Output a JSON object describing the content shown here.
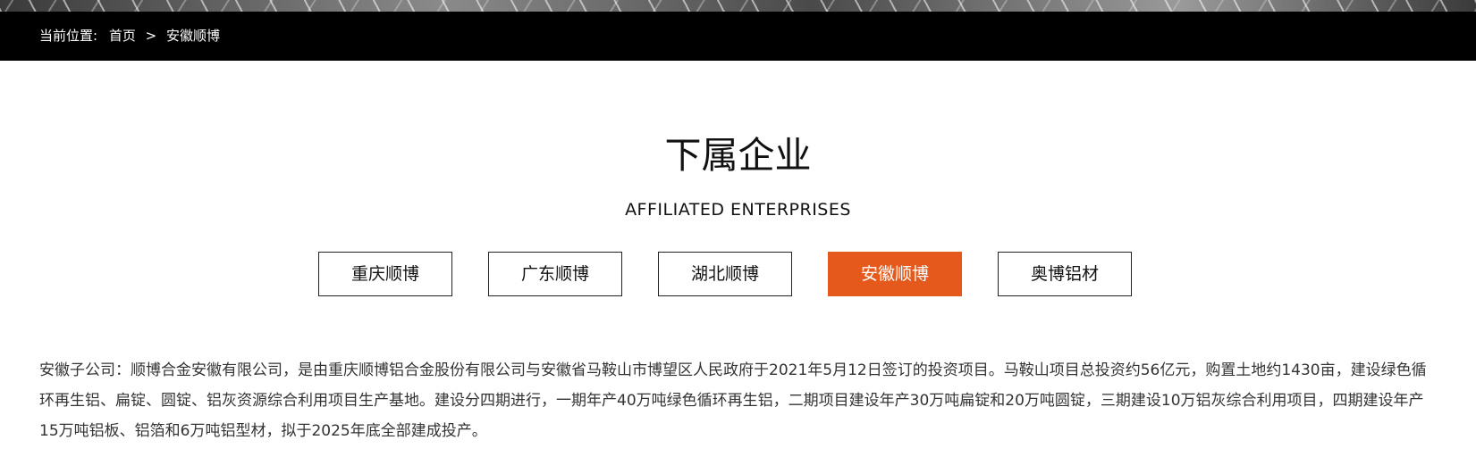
{
  "breadcrumb": {
    "prefix": "当前位置:",
    "home": "首页",
    "separator": ">",
    "current": "安徽顺博"
  },
  "section": {
    "title": "下属企业",
    "subtitle": "AFFILIATED ENTERPRISES"
  },
  "tabs": [
    {
      "label": "重庆顺博",
      "active": false
    },
    {
      "label": "广东顺博",
      "active": false
    },
    {
      "label": "湖北顺博",
      "active": false
    },
    {
      "label": "安徽顺博",
      "active": true
    },
    {
      "label": "奥博铝材",
      "active": false
    }
  ],
  "content": {
    "description": "安徽子公司：顺博合金安徽有限公司，是由重庆顺博铝合金股份有限公司与安徽省马鞍山市博望区人民政府于2021年5月12日签订的投资项目。马鞍山项目总投资约56亿元，购置土地约1430亩，建设绿色循环再生铝、扁锭、圆锭、铝灰资源综合利用项目生产基地。建设分四期进行，一期年产40万吨绿色循环再生铝，二期项目建设年产30万吨扁锭和20万吨圆锭，三期建设10万铝灰综合利用项目，四期建设年产15万吨铝板、铝箔和6万吨铝型材，拟于2025年底全部建成投产。"
  },
  "colors": {
    "accent": "#e55a1c",
    "breadcrumb_bg": "#000000"
  }
}
